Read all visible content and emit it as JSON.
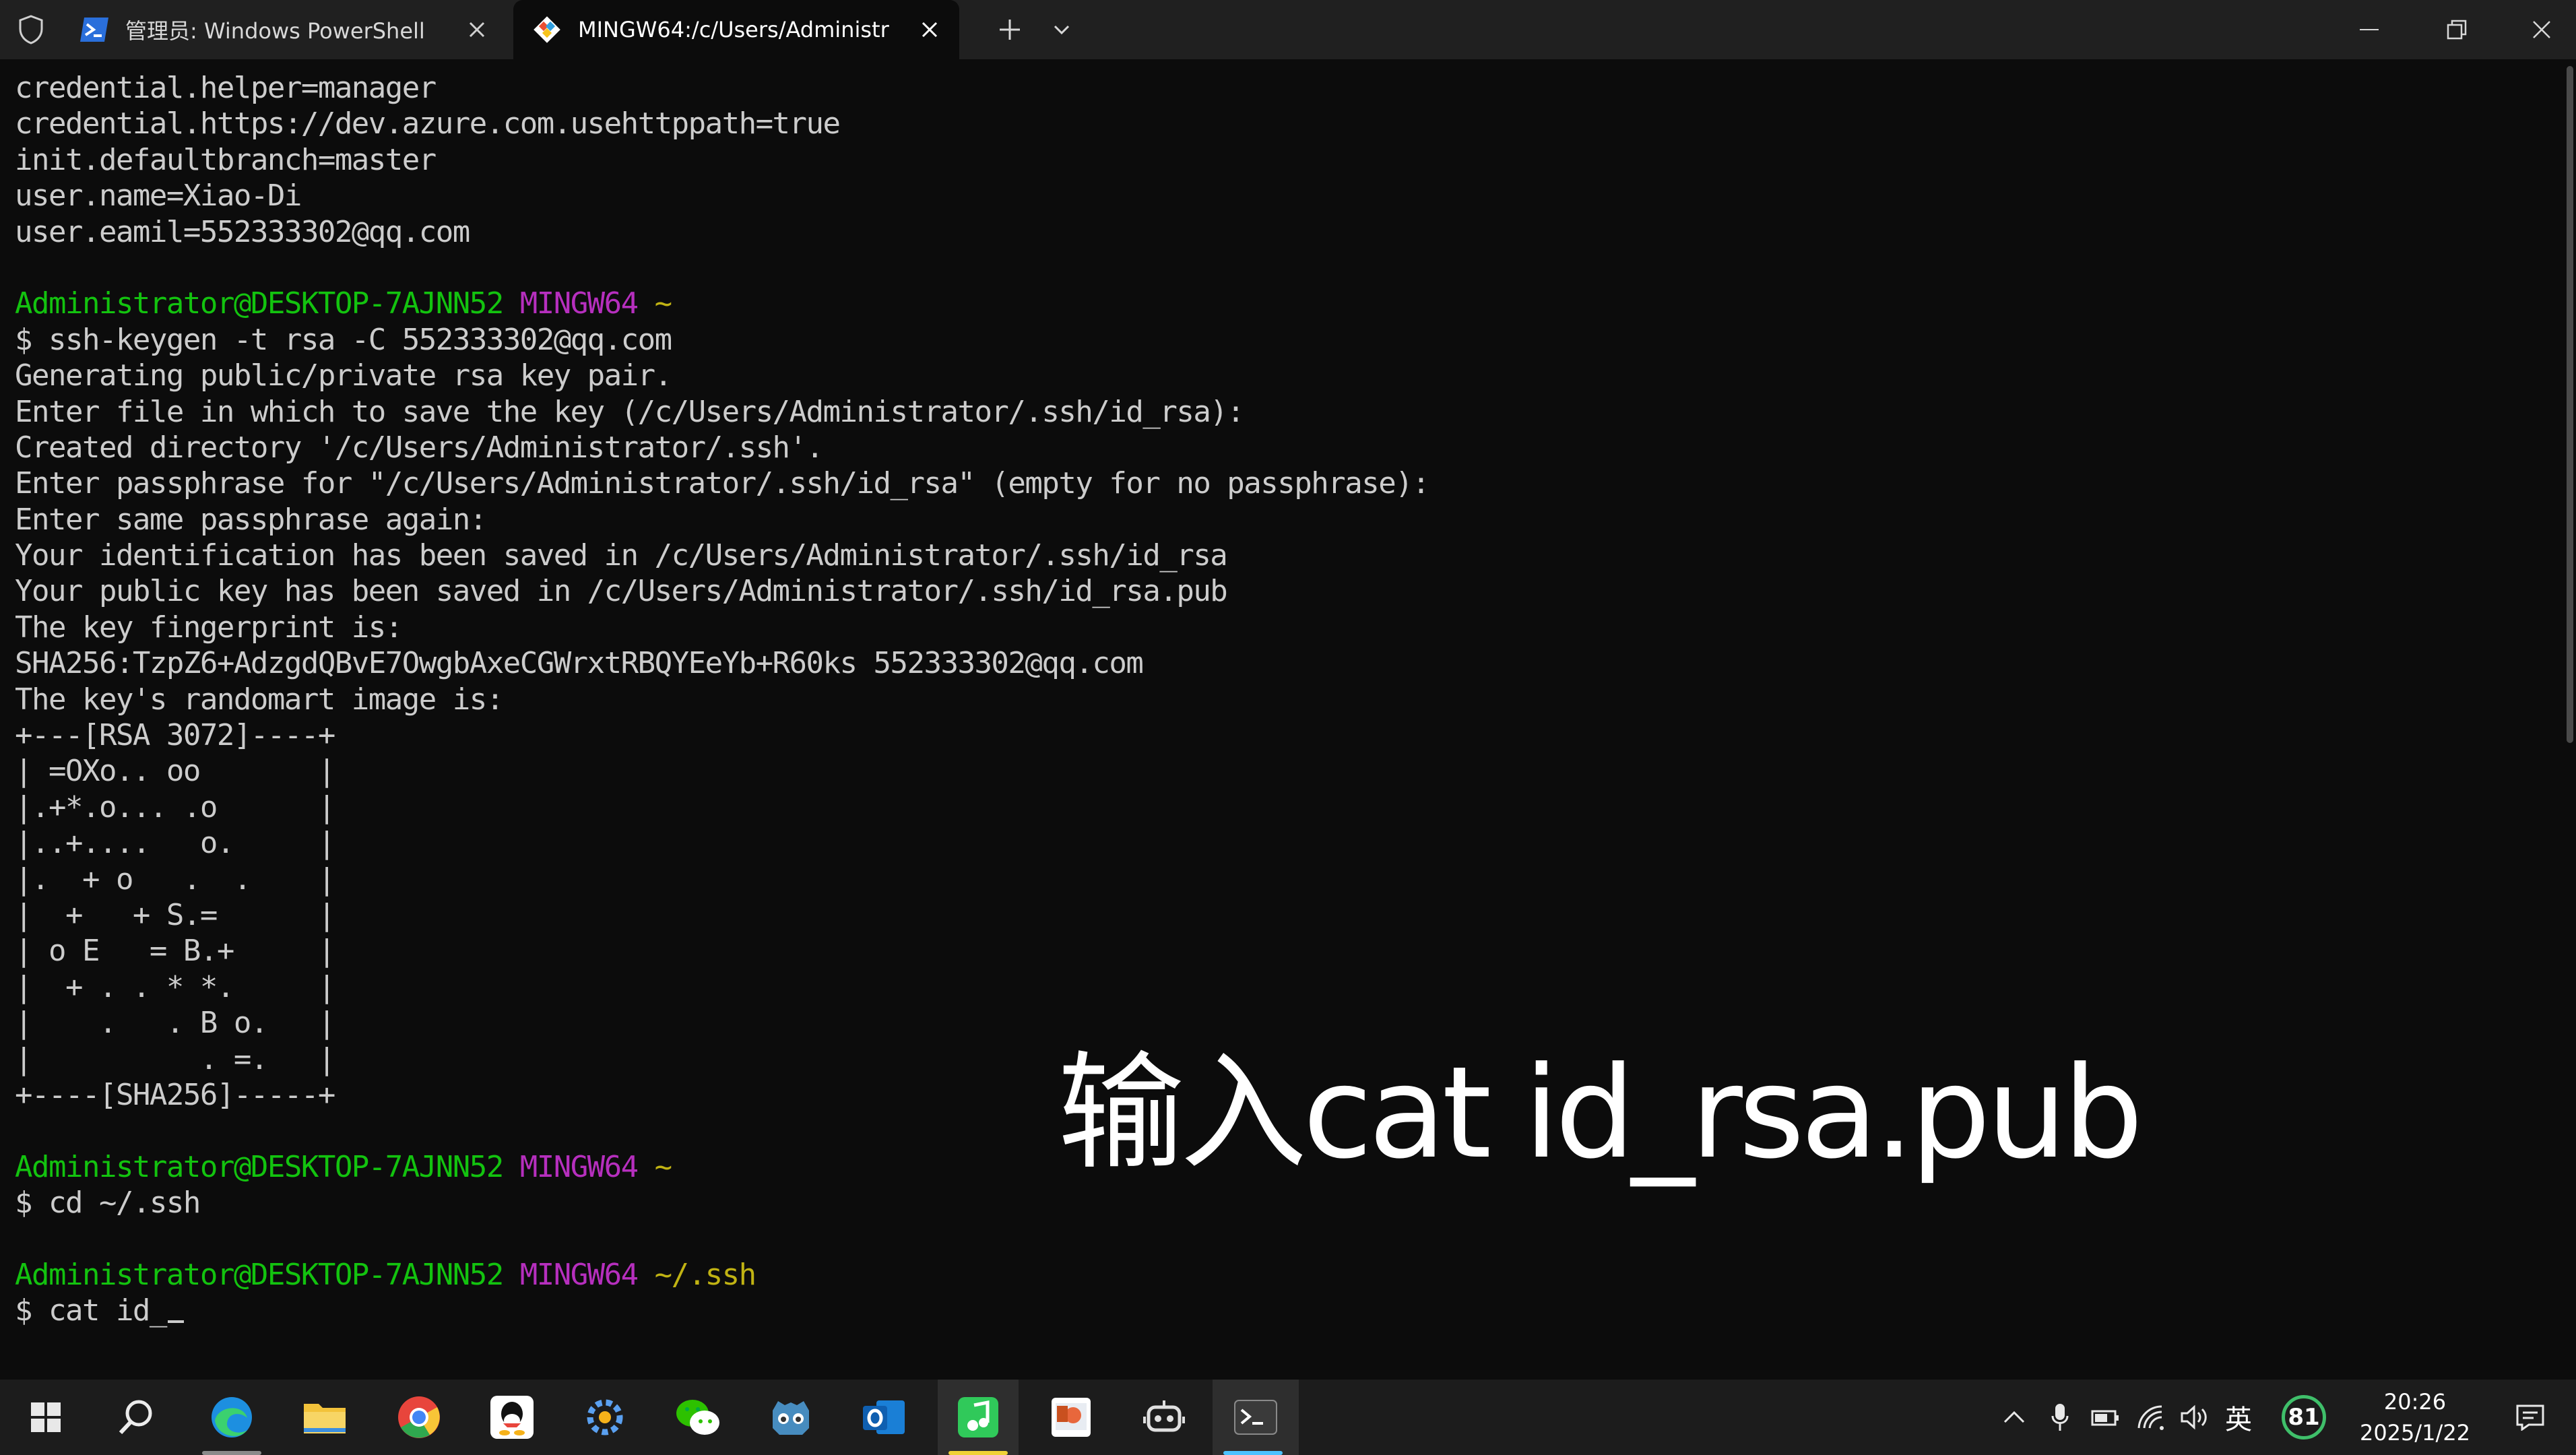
{
  "tabs": [
    {
      "title": "管理员: Windows PowerShell",
      "icon": "powershell-icon",
      "active": false
    },
    {
      "title": "MINGW64:/c/Users/Administr",
      "icon": "git-icon",
      "active": true
    }
  ],
  "terminal": {
    "lines": [
      "credential.helper=manager",
      "credential.https://dev.azure.com.usehttppath=true",
      "init.defaultbranch=master",
      "user.name=Xiao-Di",
      "user.eamil=552333302@qq.com",
      "",
      "",
      "$ ssh-keygen -t rsa -C 552333302@qq.com",
      "Generating public/private rsa key pair.",
      "Enter file in which to save the key (/c/Users/Administrator/.ssh/id_rsa):",
      "Created directory '/c/Users/Administrator/.ssh'.",
      "Enter passphrase for \"/c/Users/Administrator/.ssh/id_rsa\" (empty for no passphrase):",
      "Enter same passphrase again:",
      "Your identification has been saved in /c/Users/Administrator/.ssh/id_rsa",
      "Your public key has been saved in /c/Users/Administrator/.ssh/id_rsa.pub",
      "The key fingerprint is:",
      "SHA256:TzpZ6+AdzgdQBvE7OwgbAxeCGWrxtRBQYEeYb+R60ks 552333302@qq.com",
      "The key's randomart image is:",
      "+---[RSA 3072]----+",
      "| =OXo.. oo       |",
      "|.+*.o... .o      |",
      "|..+....   o.     |",
      "|.  + o   .  .    |",
      "|  +   + S.=      |",
      "| o E   = B.+     |",
      "|  + . . * *.     |",
      "|    .   . B o.   |",
      "|          . =.   |",
      "+----[SHA256]-----+",
      "",
      "",
      "$ cd ~/.ssh",
      "",
      "",
      "$ cat id_"
    ],
    "prompts": {
      "6": {
        "user": "Administrator@DESKTOP-7AJNN52",
        "shell": "MINGW64",
        "path": "~"
      },
      "30": {
        "user": "Administrator@DESKTOP-7AJNN52",
        "shell": "MINGW64",
        "path": "~"
      },
      "33": {
        "user": "Administrator@DESKTOP-7AJNN52",
        "shell": "MINGW64",
        "path": "~/.ssh"
      }
    }
  },
  "overlay": {
    "caption": "输入cat id_rsa.pub"
  },
  "taskbar": {
    "apps": [
      "start-icon",
      "search-icon",
      "edge-icon",
      "file-explorer-icon",
      "chrome-icon",
      "qq-icon",
      "settings-app-icon",
      "wechat-icon",
      "godot-icon",
      "outlook-icon",
      "music-app-icon",
      "powerpoint-icon",
      "robot-app-icon",
      "terminal-icon"
    ],
    "tray": {
      "ime": "英",
      "badge": "81",
      "time": "20:26",
      "date": "2025/1/22"
    }
  },
  "colors": {
    "prompt_user": "#13c30f",
    "prompt_shell": "#b62fbe",
    "prompt_path": "#c1b313",
    "accent": "#4cc2ff"
  }
}
